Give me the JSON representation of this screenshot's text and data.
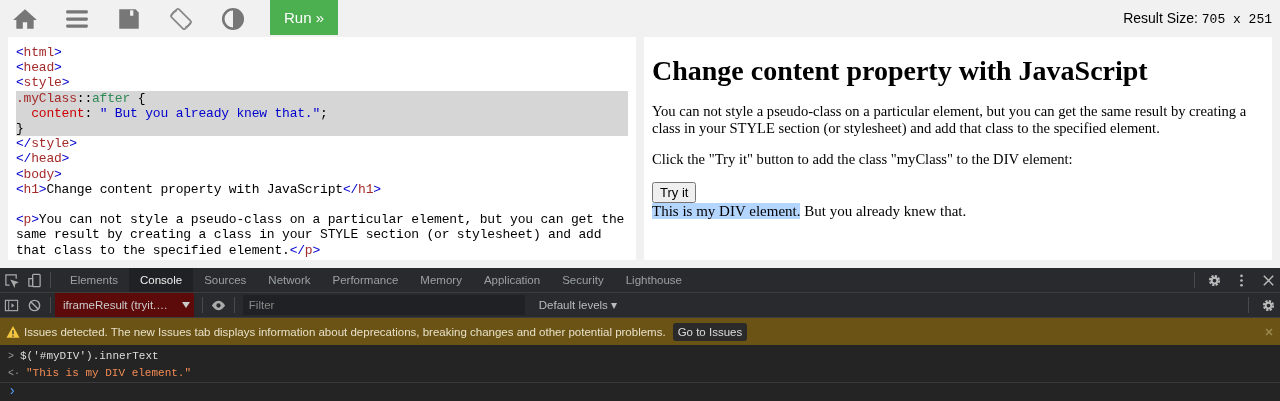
{
  "toolbar": {
    "run_button": "Run »",
    "result_size_label": "Result Size:",
    "result_size_value": "705 x 251"
  },
  "code_editor": {
    "lines": [
      {
        "highlighted": false,
        "tokens": [
          {
            "kind": "bracket",
            "text": "<"
          },
          {
            "kind": "tag",
            "text": "html"
          },
          {
            "kind": "bracket",
            "text": ">"
          }
        ]
      },
      {
        "highlighted": false,
        "tokens": [
          {
            "kind": "bracket",
            "text": "<"
          },
          {
            "kind": "tag",
            "text": "head"
          },
          {
            "kind": "bracket",
            "text": ">"
          }
        ]
      },
      {
        "highlighted": false,
        "tokens": [
          {
            "kind": "bracket",
            "text": "<"
          },
          {
            "kind": "tag",
            "text": "style"
          },
          {
            "kind": "bracket",
            "text": ">"
          }
        ]
      },
      {
        "highlighted": true,
        "tokens": [
          {
            "kind": "tag",
            "text": ".myClass"
          },
          {
            "kind": "plain",
            "text": "::"
          },
          {
            "kind": "keyword",
            "text": "after"
          },
          {
            "kind": "plain",
            "text": " {"
          }
        ]
      },
      {
        "highlighted": true,
        "tokens": [
          {
            "kind": "property",
            "text": "  content"
          },
          {
            "kind": "plain",
            "text": ": "
          },
          {
            "kind": "string",
            "text": "\" But you already knew that.\""
          },
          {
            "kind": "plain",
            "text": ";"
          }
        ]
      },
      {
        "highlighted": true,
        "tokens": [
          {
            "kind": "plain",
            "text": "}"
          }
        ]
      },
      {
        "highlighted": false,
        "tokens": [
          {
            "kind": "bracket",
            "text": "</"
          },
          {
            "kind": "tag",
            "text": "style"
          },
          {
            "kind": "bracket",
            "text": ">"
          }
        ]
      },
      {
        "highlighted": false,
        "tokens": [
          {
            "kind": "bracket",
            "text": "</"
          },
          {
            "kind": "tag",
            "text": "head"
          },
          {
            "kind": "bracket",
            "text": ">"
          }
        ]
      },
      {
        "highlighted": false,
        "tokens": [
          {
            "kind": "bracket",
            "text": "<"
          },
          {
            "kind": "tag",
            "text": "body"
          },
          {
            "kind": "bracket",
            "text": ">"
          }
        ]
      },
      {
        "highlighted": false,
        "tokens": [
          {
            "kind": "bracket",
            "text": "<"
          },
          {
            "kind": "tag",
            "text": "h1"
          },
          {
            "kind": "bracket",
            "text": ">"
          },
          {
            "kind": "plain",
            "text": "Change content property with JavaScript"
          },
          {
            "kind": "bracket",
            "text": "</"
          },
          {
            "kind": "tag",
            "text": "h1"
          },
          {
            "kind": "bracket",
            "text": ">"
          }
        ]
      },
      {
        "highlighted": false,
        "blank_line_before": true,
        "tokens": [
          {
            "kind": "bracket",
            "text": "<"
          },
          {
            "kind": "tag",
            "text": "p"
          },
          {
            "kind": "bracket",
            "text": ">"
          },
          {
            "kind": "plain",
            "text": "You can not style a pseudo-class on a particular element, but you can get the same result by creating a class in your STYLE section (or stylesheet) and add that class to the specified element."
          },
          {
            "kind": "bracket",
            "text": "</"
          },
          {
            "kind": "tag",
            "text": "p"
          },
          {
            "kind": "bracket",
            "text": ">"
          }
        ]
      }
    ]
  },
  "result": {
    "heading": "Change content property with JavaScript",
    "paragraphs": [
      "You can not style a pseudo-class on a particular element, but you can get the same result by creating a class in your STYLE section (or stylesheet) and add that class to the specified element.",
      "Click the \"Try it\" button to add the class \"myClass\" to the DIV element:"
    ],
    "try_button": "Try it",
    "div_text": "This is my DIV element.",
    "after_text": " But you already knew that."
  },
  "devtools": {
    "tabs": [
      {
        "label": "Elements",
        "selected": false
      },
      {
        "label": "Console",
        "selected": true
      },
      {
        "label": "Sources",
        "selected": false
      },
      {
        "label": "Network",
        "selected": false
      },
      {
        "label": "Performance",
        "selected": false
      },
      {
        "label": "Memory",
        "selected": false
      },
      {
        "label": "Application",
        "selected": false
      },
      {
        "label": "Security",
        "selected": false
      },
      {
        "label": "Lighthouse",
        "selected": false
      }
    ],
    "context": "iframeResult (tryit.…",
    "filter_placeholder": "Filter",
    "levels": "Default levels ▾",
    "issues_text": "Issues detected. The new Issues tab displays information about deprecations, breaking changes and other potential problems.",
    "issues_button": "Go to Issues",
    "console": [
      {
        "kind": "input",
        "prefix": ">",
        "text": "$('#myDIV').innerText"
      },
      {
        "kind": "output",
        "prefix": "<·",
        "text": "\"This is my DIV element.\""
      }
    ],
    "prompt": "›"
  }
}
